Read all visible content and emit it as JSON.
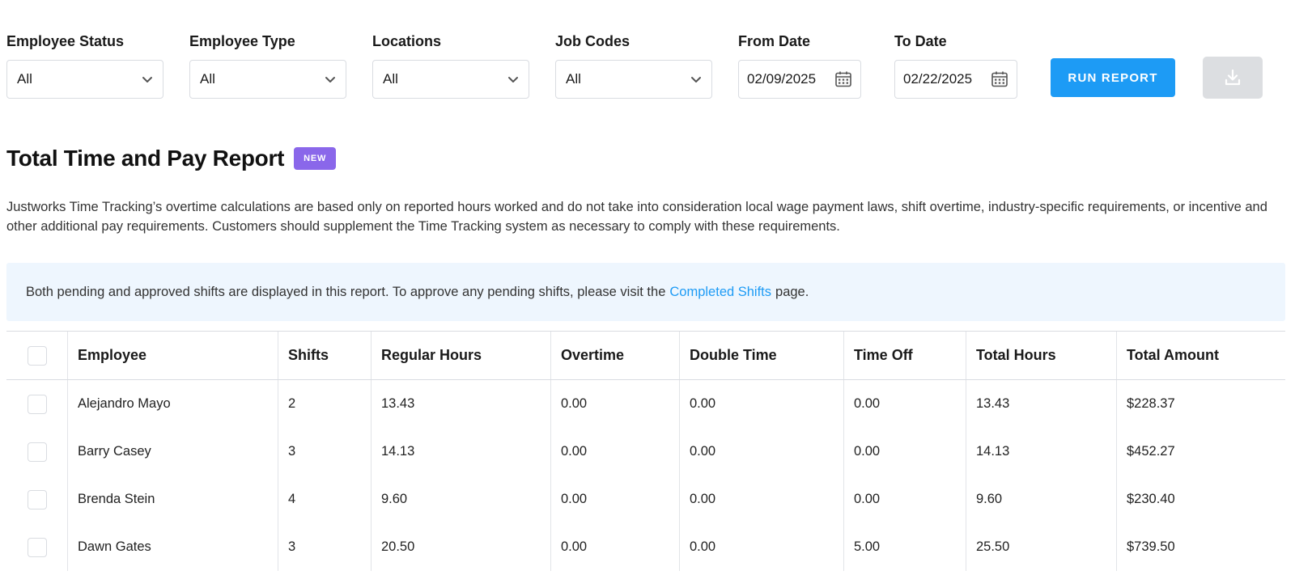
{
  "filters": {
    "employee_status": {
      "label": "Employee Status",
      "value": "All"
    },
    "employee_type": {
      "label": "Employee Type",
      "value": "All"
    },
    "locations": {
      "label": "Locations",
      "value": "All"
    },
    "job_codes": {
      "label": "Job Codes",
      "value": "All"
    },
    "from_date": {
      "label": "From Date",
      "value": "02/09/2025"
    },
    "to_date": {
      "label": "To Date",
      "value": "02/22/2025"
    }
  },
  "actions": {
    "run_report_label": "RUN REPORT",
    "download_icon": "download-icon"
  },
  "report": {
    "title": "Total Time and Pay Report",
    "badge": "NEW",
    "disclaimer": "Justworks Time Tracking’s overtime calculations are based only on reported hours worked and do not take into consideration local wage payment laws, shift overtime, industry-specific requirements, or incentive and other additional pay requirements. Customers should supplement the Time Tracking system as necessary to comply with these requirements."
  },
  "info_banner": {
    "text_before": "Both pending and approved shifts are displayed in this report. To approve any pending shifts, please visit the",
    "link_text": "Completed Shifts",
    "text_after": "page."
  },
  "table": {
    "columns": [
      "Employee",
      "Shifts",
      "Regular Hours",
      "Overtime",
      "Double Time",
      "Time Off",
      "Total Hours",
      "Total Amount"
    ],
    "rows": [
      [
        "Alejandro Mayo",
        "2",
        "13.43",
        "0.00",
        "0.00",
        "0.00",
        "13.43",
        "$228.37"
      ],
      [
        "Barry Casey",
        "3",
        "14.13",
        "0.00",
        "0.00",
        "0.00",
        "14.13",
        "$452.27"
      ],
      [
        "Brenda Stein",
        "4",
        "9.60",
        "0.00",
        "0.00",
        "0.00",
        "9.60",
        "$230.40"
      ],
      [
        "Dawn Gates",
        "3",
        "20.50",
        "0.00",
        "0.00",
        "5.00",
        "25.50",
        "$739.50"
      ]
    ]
  },
  "colors": {
    "primary": "#1d9bf5",
    "badge": "#8a67ea",
    "info_bg": "#eef6fe",
    "disabled": "#dcdee1"
  }
}
